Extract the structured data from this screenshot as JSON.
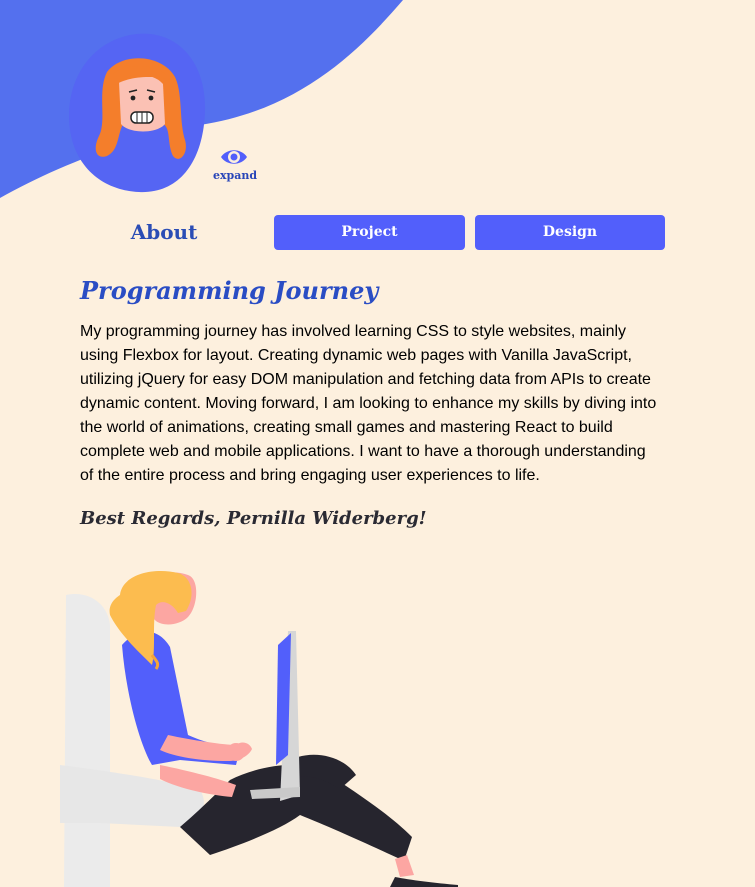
{
  "header": {
    "expand_label": "expand"
  },
  "tabs": [
    {
      "label": "About"
    },
    {
      "label": "Project"
    },
    {
      "label": "Design"
    }
  ],
  "main": {
    "heading": "Programming Journey",
    "paragraph": "My programming journey has involved learning CSS to style websites, mainly using Flexbox for layout. Creating dynamic web pages with Vanilla JavaScript, utilizing jQuery for easy DOM manipulation and fetching data from APIs to create dynamic content. Moving forward, I am looking to enhance my skills by diving into the world of animations, creating small games and mastering React to build complete web and mobile applications. I want to have a thorough understanding of the entire process and bring engaging user experiences to life.",
    "signature": "Best Regards, Pernilla Widerberg!"
  },
  "colors": {
    "background": "#fdf0de",
    "accent": "#525ffb",
    "heading": "#2a4dc4"
  },
  "icons": [
    "eye-icon"
  ]
}
